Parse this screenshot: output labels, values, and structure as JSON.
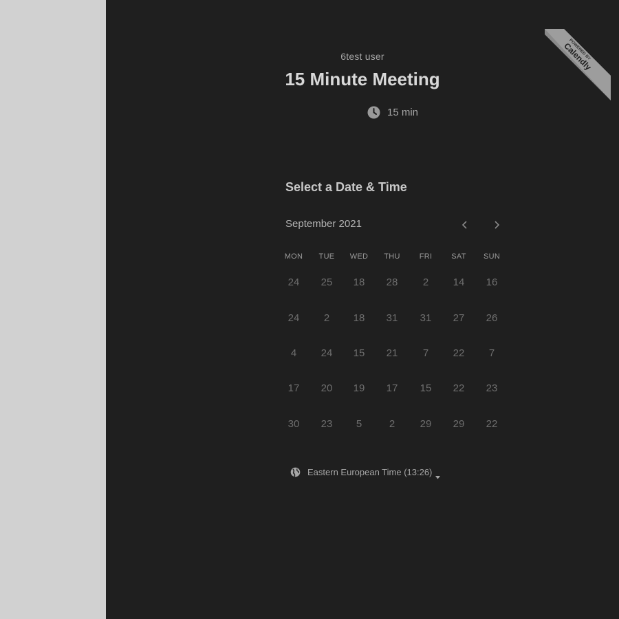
{
  "colors": {
    "page_background": "#d1d1d1",
    "panel_background": "#1f1f1f",
    "badge": "#8a8a8a"
  },
  "header": {
    "owner_name": "6test user",
    "event_title": "15 Minute Meeting",
    "duration": "15 min",
    "duration_icon": "clock-icon"
  },
  "badge": {
    "line1": "POWERED BY",
    "line2": "Calendly"
  },
  "calendar": {
    "section_title": "Select a Date & Time",
    "month": "September 2021",
    "prev_icon": "chevron-left-icon",
    "next_icon": "chevron-right-icon",
    "weekdays": [
      "MON",
      "TUE",
      "WED",
      "THU",
      "FRI",
      "SAT",
      "SUN"
    ],
    "weeks": [
      [
        "24",
        "25",
        "18",
        "28",
        "2",
        "14",
        "16"
      ],
      [
        "24",
        "2",
        "18",
        "31",
        "31",
        "27",
        "26"
      ],
      [
        "4",
        "24",
        "15",
        "21",
        "7",
        "22",
        "7"
      ],
      [
        "17",
        "20",
        "19",
        "17",
        "15",
        "22",
        "23"
      ],
      [
        "30",
        "23",
        "5",
        "2",
        "29",
        "29",
        "22"
      ]
    ]
  },
  "timezone": {
    "label": "Eastern European Time (13:26)",
    "icon": "globe-icon"
  }
}
